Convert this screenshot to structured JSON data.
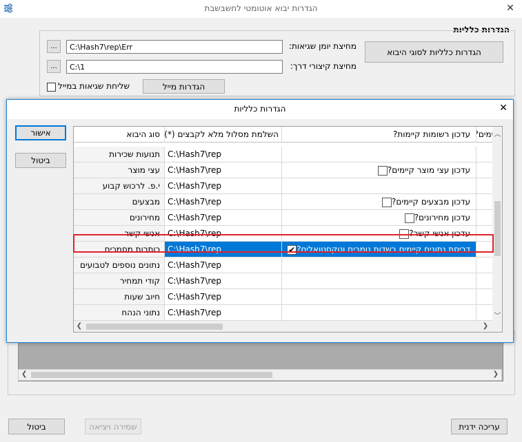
{
  "window": {
    "title": "הגדרות יבוא אוטומטי לחשבשבת",
    "close": "✕"
  },
  "group": {
    "title": "הגדרות כלליות",
    "general_types_btn": "הגדרות כלליות לסוגי היבוא",
    "error_log_label": "מחיצת יומן שגיאות:",
    "error_log_value": "C:\\Hash7\\rep\\Err",
    "shortcut_label": "מחיצת קיצורי דרך:",
    "shortcut_value": "C:\\1",
    "browse": "...",
    "send_mail_label": "שליחת שגיאות במייל",
    "mail_settings_btn": "הגדרות מייל"
  },
  "bottom": {
    "cancel": "ביטול",
    "save_exit": "שמירה ויציאה",
    "manual_edit": "עריכה ידנית"
  },
  "dialog": {
    "title": "הגדרות כלליות",
    "close": "✕",
    "ok": "אישור",
    "cancel": "ביטול",
    "columns": {
      "type": "סוג היבוא",
      "path": "השלמת מסלול מלא לקבצים (*)",
      "update": "עדכון רשומות קיימות?",
      "extra": "יימים?"
    },
    "rows": [
      {
        "type": "תנועות שכירות",
        "path": "C:\\Hash7\\rep",
        "update": ""
      },
      {
        "type": "עצי מוצר",
        "path": "C:\\Hash7\\rep",
        "update": "עדכון עצי מוצר קיימים?"
      },
      {
        "type": "י.פ. לרכוש קבוע",
        "path": "C:\\Hash7\\rep",
        "update": ""
      },
      {
        "type": "מבצעים",
        "path": "C:\\Hash7\\rep",
        "update": "עדכון מבצעים קיימים?"
      },
      {
        "type": "מחירונים",
        "path": "C:\\Hash7\\rep",
        "update": "עדכון מחירונים?"
      },
      {
        "type": "אנשי קשר",
        "path": "C:\\Hash7\\rep",
        "update": "עדכון אנשי קשר?"
      },
      {
        "type": "כותרות מסמכים",
        "path": "C:\\Hash7\\rep",
        "update": "דריסת נתונים קיימים בשדות נומרים וטקסטואלים?"
      },
      {
        "type": "נתונים נוספים לטבועים",
        "path": "C:\\Hash7\\rep",
        "update": ""
      },
      {
        "type": "קודי תמחיר",
        "path": "C:\\Hash7\\rep",
        "update": ""
      },
      {
        "type": "חיוב שעות",
        "path": "C:\\Hash7\\rep",
        "update": ""
      },
      {
        "type": "נתוני הנהח",
        "path": "C:\\Hash7\\rep",
        "update": ""
      }
    ],
    "checkmark": "✔"
  },
  "colors": {
    "selection": "#0078d7",
    "highlight_border": "#e0202a",
    "accent": "#1883d7"
  }
}
